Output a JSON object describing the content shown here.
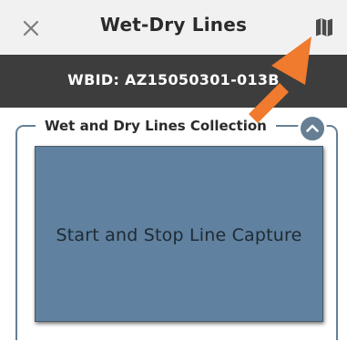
{
  "header": {
    "title": "Wet-Dry Lines",
    "close_icon": "close-icon",
    "map_icon": "map-icon"
  },
  "banner": {
    "wbid": "WBID: AZ15050301-013B"
  },
  "section": {
    "legend": "Wet and Dry Lines Collection",
    "collapse_icon": "chevron-up-icon"
  },
  "capture_button": {
    "label": "Start and Stop Line Capture"
  },
  "colors": {
    "header_bg": "#f1f1f1",
    "banner_bg": "#3d3d3d",
    "panel_border": "#667f94",
    "capture_bg": "#60819f",
    "annotation_arrow": "#f07a2e"
  }
}
